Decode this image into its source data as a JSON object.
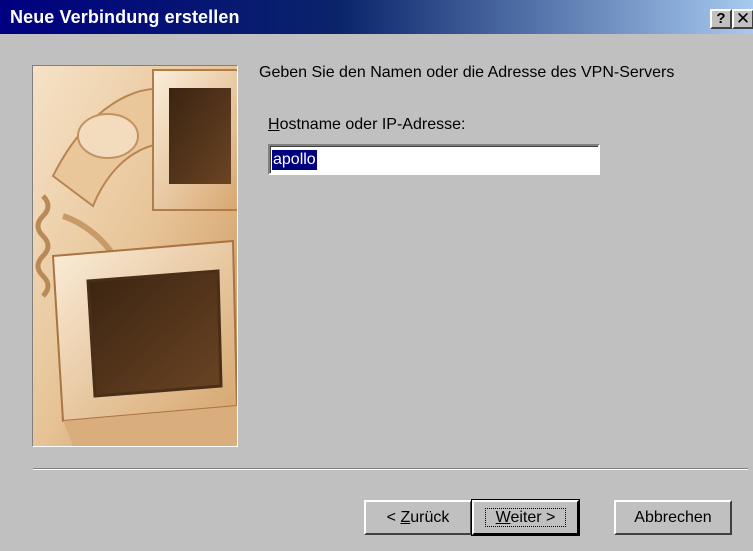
{
  "window": {
    "title": "Neue Verbindung erstellen",
    "help_glyph": "?",
    "close_glyph": "✕"
  },
  "wizard": {
    "image_icon": "telephone-and-monitors-illustration",
    "instruction": "Geben Sie den Namen oder die Adresse des VPN-Servers",
    "field_label_mnemonic": "H",
    "field_label_rest": "ostname oder IP-Adresse:",
    "host_value": "apollo"
  },
  "buttons": {
    "back_prefix": "< ",
    "back_mnemonic": "Z",
    "back_rest": "urück",
    "next_mnemonic": "W",
    "next_rest": "eiter >",
    "cancel": "Abbrechen"
  },
  "colors": {
    "titlebar_start": "#000080",
    "titlebar_end": "#a6caf0",
    "face": "#c0c0c0",
    "selection": "#000080"
  }
}
